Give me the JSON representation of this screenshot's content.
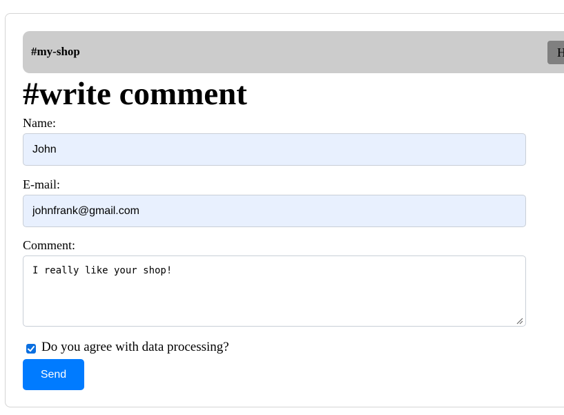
{
  "navbar": {
    "brand": "#my-shop",
    "button_label": "H"
  },
  "page": {
    "title": "#write comment"
  },
  "form": {
    "name_label": "Name:",
    "name_value": "John",
    "email_label": "E-mail:",
    "email_value": "johnfrank@gmail.com",
    "comment_label": "Comment:",
    "comment_value": "I really like your shop!",
    "agree_label": "Do you agree with data processing?",
    "agree_checked": true,
    "send_label": "Send"
  },
  "colors": {
    "navbar_bg": "#cccccc",
    "nav_button_bg": "#808080",
    "input_bg": "#e8f0fe",
    "send_button_bg": "#007bff",
    "checkbox_accent": "#0b6fe0"
  },
  "icons": {
    "checkbox": "checkmark-icon",
    "textarea_resize": "resize-handle-icon"
  }
}
